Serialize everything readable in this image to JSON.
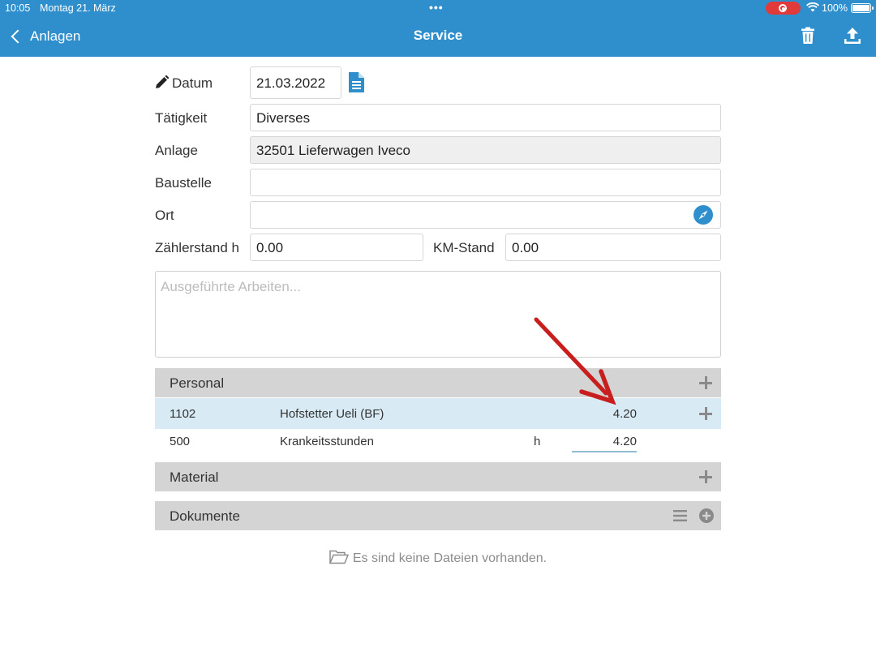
{
  "status_bar": {
    "time": "10:05",
    "date": "Montag 21. März",
    "dots": "•••",
    "battery": "100%"
  },
  "nav": {
    "back_label": "Anlagen",
    "title": "Service"
  },
  "form": {
    "datum_label": "Datum",
    "datum_value": "21.03.2022",
    "taetigkeit_label": "Tätigkeit",
    "taetigkeit_value": "Diverses",
    "anlage_label": "Anlage",
    "anlage_value": "32501 Lieferwagen Iveco",
    "baustelle_label": "Baustelle",
    "baustelle_value": "",
    "ort_label": "Ort",
    "ort_value": "",
    "zaehlerstand_label": "Zählerstand h",
    "zaehlerstand_value": "0.00",
    "kmstand_label": "KM-Stand",
    "kmstand_value": "0.00",
    "arbeiten_placeholder": "Ausgeführte Arbeiten..."
  },
  "personal": {
    "title": "Personal",
    "rows": [
      {
        "code": "1102",
        "name": "Hofstetter Ueli (BF)",
        "unit": "",
        "value": "4.20"
      },
      {
        "code": "500",
        "name": "Krankeitsstunden",
        "unit": "h",
        "value": "4.20"
      }
    ]
  },
  "material": {
    "title": "Material"
  },
  "dokumente": {
    "title": "Dokumente",
    "empty_text": "Es sind keine Dateien vorhanden."
  },
  "colors": {
    "header": "#2e8fcc",
    "section": "#d4d4d4",
    "selected_row": "#d8ebf5",
    "arrow": "#c81e1e"
  }
}
